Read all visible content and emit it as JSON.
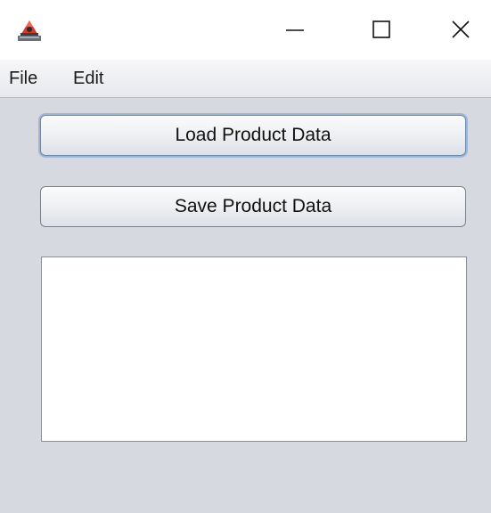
{
  "window": {
    "titlebar": {
      "icons": {
        "app": "java-app-icon",
        "minimize": "minimize-icon",
        "maximize": "maximize-icon",
        "close": "close-icon"
      }
    },
    "menu": {
      "items": [
        {
          "label": "File"
        },
        {
          "label": "Edit"
        }
      ]
    },
    "buttons": {
      "load_label": "Load Product Data",
      "save_label": "Save Product Data"
    },
    "output_area": {
      "value": ""
    }
  }
}
